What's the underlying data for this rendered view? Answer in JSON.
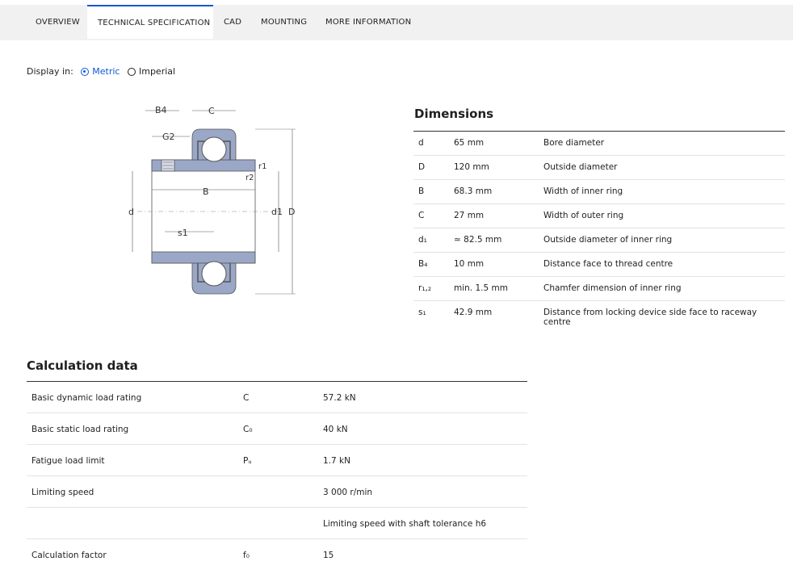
{
  "tabs": [
    "OVERVIEW",
    "TECHNICAL SPECIFICATION",
    "CAD",
    "MOUNTING",
    "MORE INFORMATION"
  ],
  "display": {
    "label": "Display in:",
    "metric": "Metric",
    "imperial": "Imperial",
    "selected": "Metric"
  },
  "drawing": {
    "labels": {
      "b4": "B4",
      "c": "C",
      "g2": "G2",
      "r1": "r1",
      "r2": "r2",
      "b": "B",
      "d": "d",
      "d1": "d1",
      "D": "D",
      "s1": "s1"
    }
  },
  "dimensions": {
    "title": "Dimensions",
    "rows": [
      {
        "symbol": "d",
        "value": "65 mm",
        "desc": "Bore diameter"
      },
      {
        "symbol": "D",
        "value": "120 mm",
        "desc": "Outside diameter"
      },
      {
        "symbol": "B",
        "value": "68.3 mm",
        "desc": "Width of inner ring"
      },
      {
        "symbol": "C",
        "value": "27 mm",
        "desc": "Width of outer ring"
      },
      {
        "symbol": "d₁",
        "value": "≈ 82.5 mm",
        "desc": "Outside diameter of inner ring"
      },
      {
        "symbol": "B₄",
        "value": "10 mm",
        "desc": "Distance face to thread centre"
      },
      {
        "symbol": "r₁,₂",
        "value": "min. 1.5 mm",
        "desc": "Chamfer dimension of inner ring"
      },
      {
        "symbol": "s₁",
        "value": "42.9 mm",
        "desc": "Distance from locking device side face to raceway centre"
      }
    ]
  },
  "calculation": {
    "title": "Calculation data",
    "rows": [
      {
        "label": "Basic dynamic load rating",
        "symbol": "C",
        "value": "57.2 kN"
      },
      {
        "label": "Basic static load rating",
        "symbol": "C₀",
        "value": "40 kN"
      },
      {
        "label": "Fatigue load limit",
        "symbol": "Pᵤ",
        "value": "1.7 kN"
      },
      {
        "label": "Limiting speed",
        "symbol": "",
        "value": "3 000 r/min"
      },
      {
        "label": "",
        "symbol": "",
        "value": "Limiting speed with shaft tolerance h6"
      },
      {
        "label": "Calculation factor",
        "symbol": "f₀",
        "value": "15"
      }
    ]
  },
  "colors": {
    "accent": "#0f58d6",
    "ring_fill": "#9aa7c6",
    "tab_bar": "#f1f1f1"
  }
}
